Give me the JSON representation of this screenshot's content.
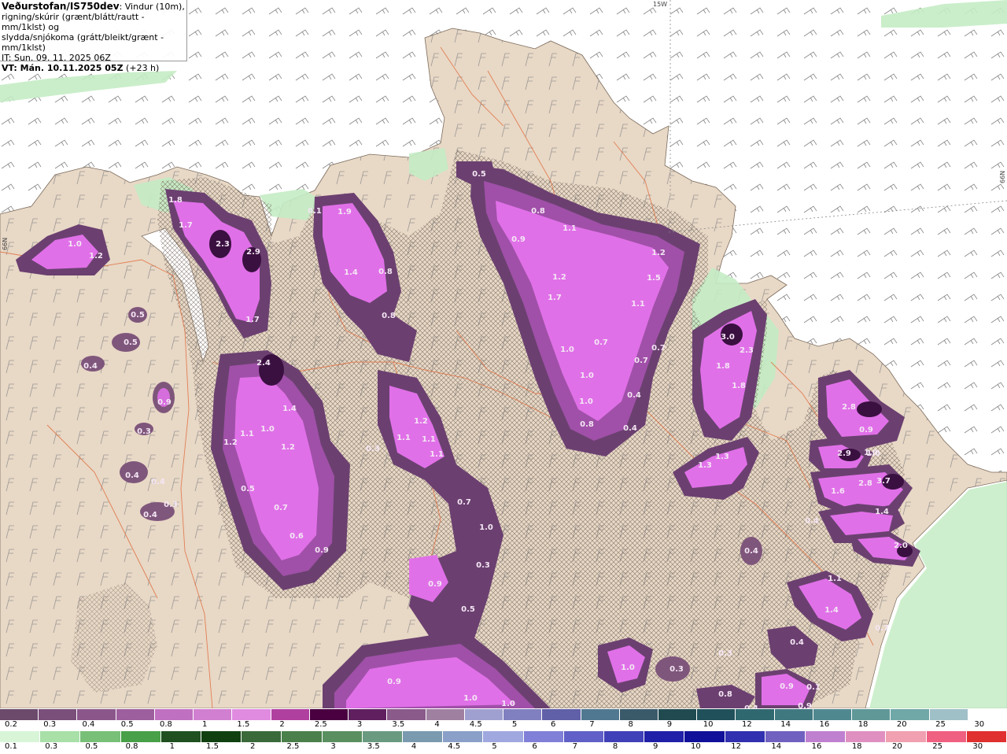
{
  "header": {
    "title_bold": "Veðurstofan/IS750dev",
    "title_rest": ": Vindur (10m),",
    "line2": "rigning/skúrir (grænt/blátt/rautt - mm/1klst) og",
    "line3": "slydda/snjókoma (grátt/bleikt/grænt - mm/1klst)",
    "init_time": "IT: Sun. 09. 11. 2025 06Z",
    "valid_time_bold": "VT: Mán. 10.11.2025 05Z",
    "valid_offset": " (+23 h)"
  },
  "axis_labels": {
    "lon": "15W",
    "lat_left": "66N",
    "lat_right": "66N"
  },
  "precip_values": [
    {
      "text": "0.5"
    },
    {
      "text": "0.8"
    },
    {
      "text": "0.9"
    },
    {
      "text": "1.1"
    },
    {
      "text": "1.2"
    },
    {
      "text": "1.5"
    },
    {
      "text": "1.2"
    },
    {
      "text": "1.7"
    },
    {
      "text": "1.1"
    },
    {
      "text": "1.0"
    },
    {
      "text": "0.7"
    },
    {
      "text": "0.7"
    },
    {
      "text": "0.7"
    },
    {
      "text": "1.0"
    },
    {
      "text": "1.0"
    },
    {
      "text": "0.4"
    },
    {
      "text": "0.8"
    },
    {
      "text": "0.4"
    },
    {
      "text": "1.8"
    },
    {
      "text": "1.7"
    },
    {
      "text": "2.3"
    },
    {
      "text": "2.9"
    },
    {
      "text": "1.7"
    },
    {
      "text": "1.0"
    },
    {
      "text": "1.2"
    },
    {
      "text": "0.5"
    },
    {
      "text": "0.5"
    },
    {
      "text": "0.4"
    },
    {
      "text": "0.9"
    },
    {
      "text": "0.3"
    },
    {
      "text": "0.4"
    },
    {
      "text": "0.4"
    },
    {
      "text": "0.4"
    },
    {
      "text": "0.3"
    },
    {
      "text": "1.9"
    },
    {
      "text": "1.4"
    },
    {
      "text": "0.8"
    },
    {
      "text": "0.8"
    },
    {
      "text": "2.4"
    },
    {
      "text": "1.4"
    },
    {
      "text": "1.1"
    },
    {
      "text": "1.0"
    },
    {
      "text": "1.2"
    },
    {
      "text": "1.2"
    },
    {
      "text": "0.5"
    },
    {
      "text": "0.7"
    },
    {
      "text": "0.6"
    },
    {
      "text": "0.9"
    },
    {
      "text": "1.2"
    },
    {
      "text": "1.1"
    },
    {
      "text": "1.1"
    },
    {
      "text": "1.1"
    },
    {
      "text": "0.3"
    },
    {
      "text": "0.7"
    },
    {
      "text": "1.0"
    },
    {
      "text": "0.3"
    },
    {
      "text": "0.5"
    },
    {
      "text": "0.9"
    },
    {
      "text": "0.9"
    },
    {
      "text": "1.0"
    },
    {
      "text": "1.0"
    },
    {
      "text": "0.1"
    },
    {
      "text": "3.0"
    },
    {
      "text": "2.3"
    },
    {
      "text": "1.8"
    },
    {
      "text": "1.8"
    },
    {
      "text": "1.3"
    },
    {
      "text": "1.3"
    },
    {
      "text": "0.4"
    },
    {
      "text": "2.8"
    },
    {
      "text": "0.9"
    },
    {
      "text": "2.9"
    },
    {
      "text": "1.0"
    },
    {
      "text": "1.6"
    },
    {
      "text": "2.8"
    },
    {
      "text": "3.7"
    },
    {
      "text": "1.4"
    },
    {
      "text": "0.4"
    },
    {
      "text": "2.0"
    },
    {
      "text": "1.1"
    },
    {
      "text": "1.4"
    },
    {
      "text": "0.7"
    },
    {
      "text": "0.4"
    },
    {
      "text": "0.3"
    },
    {
      "text": "0.3"
    },
    {
      "text": "1.0"
    },
    {
      "text": "0.9"
    },
    {
      "text": "0.1"
    },
    {
      "text": "0.9"
    },
    {
      "text": "0.8"
    },
    {
      "text": "0.4"
    },
    {
      "text": "1.0"
    }
  ],
  "legend_snow": {
    "labels": [
      "0.2",
      "0.3",
      "0.4",
      "0.5",
      "0.8",
      "1",
      "1.5",
      "2",
      "2.5",
      "3",
      "3.5",
      "4",
      "4.5",
      "5",
      "6",
      "7",
      "8",
      "9",
      "10",
      "12",
      "14",
      "16",
      "18",
      "20",
      "25",
      "30"
    ],
    "colors": [
      "#6b4a6b",
      "#7a4f7a",
      "#8b578b",
      "#9d5f9d",
      "#c070c0",
      "#d17fd1",
      "#e08be0",
      "#b040a0",
      "#4a0040",
      "#602060",
      "#8a5a8a",
      "#a080a0",
      "#a0a0d0",
      "#8080c0",
      "#6060a8",
      "#507890",
      "#3a5a6a",
      "#204a50",
      "#20505a",
      "#306870",
      "#407880",
      "#508890",
      "#609898",
      "#70a8a8",
      "#a0c0c8",
      "#ffffff"
    ]
  },
  "legend_rain": {
    "labels": [
      "0.1",
      "0.3",
      "0.5",
      "0.8",
      "1",
      "1.5",
      "2",
      "2.5",
      "3",
      "3.5",
      "4",
      "4.5",
      "5",
      "6",
      "7",
      "8",
      "9",
      "10",
      "12",
      "14",
      "16",
      "18",
      "20",
      "25",
      "30"
    ],
    "colors": [
      "#d8f5d8",
      "#a8e0a8",
      "#78c078",
      "#48a048",
      "#205020",
      "#104010",
      "#3a6a3a",
      "#4a804a",
      "#5a9060",
      "#6a9a80",
      "#7a9ab0",
      "#8aa0c8",
      "#a0a8e0",
      "#8080d8",
      "#6060c8",
      "#4040b8",
      "#2020a8",
      "#10109a",
      "#3030b0",
      "#7060c0",
      "#c080d0",
      "#e090c0",
      "#f0a0b0",
      "#f06080",
      "#e03030"
    ]
  },
  "colors": {
    "land": "#e8d8c8",
    "ocean": "#ffffff",
    "rain_light": "#c8f0c8",
    "snow_dark": "#6b4070",
    "snow_mid": "#a050a8",
    "snow_light": "#e070e8",
    "roads": "#e07040"
  }
}
